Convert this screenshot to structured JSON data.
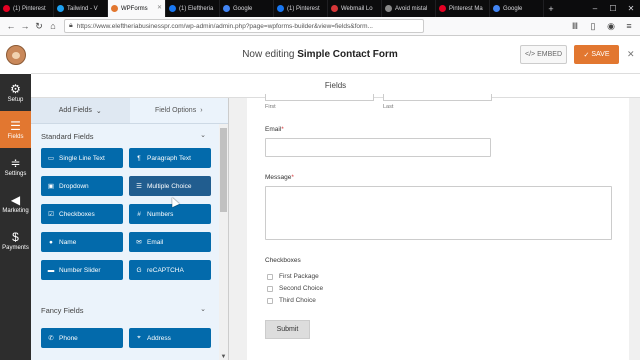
{
  "browser": {
    "tabs": [
      {
        "label": "(1) Pinterest",
        "color": "#e60023"
      },
      {
        "label": "Tailwind - V",
        "color": "#1da1f2"
      },
      {
        "label": "WPForms",
        "color": "#e27730",
        "active": true
      },
      {
        "label": "(1) Eleftheria",
        "color": "#1877f2"
      },
      {
        "label": "Google",
        "color": "#4285f4"
      },
      {
        "label": "(1) Pinterest",
        "color": "#1877f2"
      },
      {
        "label": "Webmail Lo",
        "color": "#d63638"
      },
      {
        "label": "Avoid mistal",
        "color": "#888888"
      },
      {
        "label": "Pinterest Ma",
        "color": "#e60023"
      },
      {
        "label": "Google",
        "color": "#4285f4"
      }
    ],
    "url": "https://www.eleftheriabusinesspr.com/wp-admin/admin.php?page=wpforms-builder&view=fields&form..."
  },
  "header": {
    "editing_prefix": "Now editing",
    "form_name": "Simple Contact Form",
    "embed_label": "EMBED",
    "save_label": "SAVE"
  },
  "sidebar": {
    "items": [
      {
        "label": "Setup",
        "icon": "gear-icon"
      },
      {
        "label": "Fields",
        "icon": "list-icon",
        "active": true
      },
      {
        "label": "Settings",
        "icon": "sliders-icon"
      },
      {
        "label": "Marketing",
        "icon": "megaphone-icon"
      },
      {
        "label": "Payments",
        "icon": "dollar-icon"
      }
    ]
  },
  "fields_title": "Fields",
  "panel": {
    "tab_add": "Add Fields",
    "tab_options": "Field Options",
    "standard_heading": "Standard Fields",
    "standard_fields": [
      {
        "label": "Single Line Text",
        "icon": "text-line-icon"
      },
      {
        "label": "Paragraph Text",
        "icon": "paragraph-icon"
      },
      {
        "label": "Dropdown",
        "icon": "dropdown-icon"
      },
      {
        "label": "Multiple Choice",
        "icon": "list-icon"
      },
      {
        "label": "Checkboxes",
        "icon": "checkbox-icon"
      },
      {
        "label": "Numbers",
        "icon": "hash-icon"
      },
      {
        "label": "Name",
        "icon": "user-icon"
      },
      {
        "label": "Email",
        "icon": "envelope-icon"
      },
      {
        "label": "Number Slider",
        "icon": "slider-icon"
      },
      {
        "label": "reCAPTCHA",
        "icon": "google-icon"
      }
    ],
    "fancy_heading": "Fancy Fields",
    "fancy_fields": [
      {
        "label": "Phone",
        "icon": "phone-icon"
      },
      {
        "label": "Address",
        "icon": "pin-icon"
      }
    ]
  },
  "form": {
    "first_sub": "First",
    "last_sub": "Last",
    "email_label": "Email",
    "message_label": "Message",
    "required_mark": "*",
    "checkboxes_label": "Checkboxes",
    "choices": [
      "First Package",
      "Second Choice",
      "Third Choice"
    ],
    "submit_label": "Submit"
  }
}
